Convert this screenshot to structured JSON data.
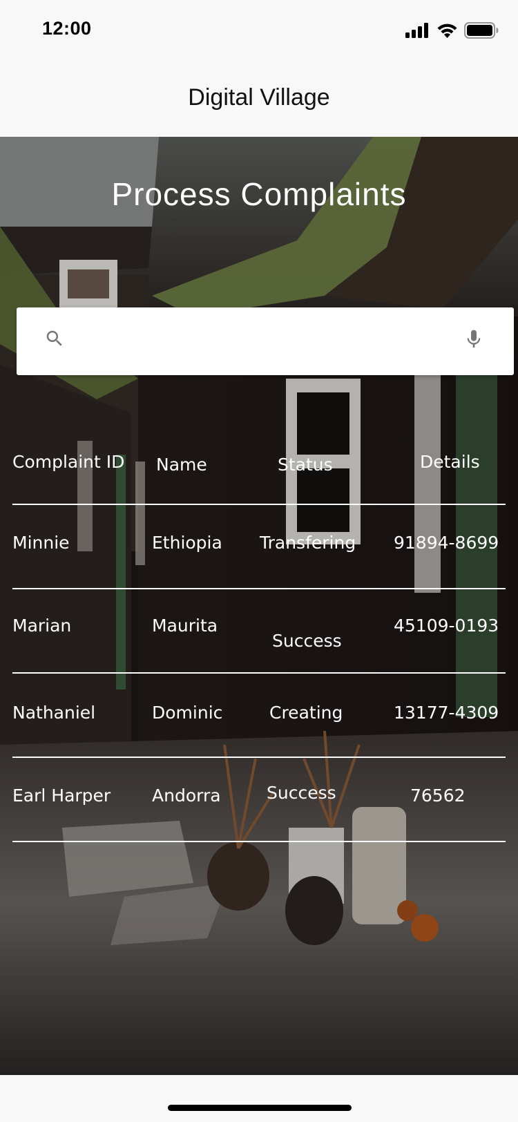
{
  "status_bar": {
    "time": "12:00",
    "icons": [
      "cellular-signal-icon",
      "wifi-icon",
      "battery-icon"
    ]
  },
  "app": {
    "title": "Digital Village"
  },
  "page": {
    "title": "Process Complaints"
  },
  "search": {
    "value": "",
    "placeholder": "",
    "icons": [
      "search-icon",
      "microphone-icon"
    ]
  },
  "table": {
    "headers": {
      "complaint_id": "Complaint ID",
      "name": "Name",
      "status": "Status",
      "details": "Details"
    },
    "rows": [
      {
        "complaint_id": "Minnie",
        "name": "Ethiopia",
        "status": "Transfering",
        "details": "91894-8699"
      },
      {
        "complaint_id": "Marian",
        "name": "Maurita",
        "status": "Success",
        "details": "45109-0193"
      },
      {
        "complaint_id": "Nathaniel",
        "name": "Dominic",
        "status": "Creating",
        "details": "13177-4309"
      },
      {
        "complaint_id": "Earl Harper",
        "name": "Andorra",
        "status": "Success",
        "details": "76562"
      }
    ]
  },
  "colors": {
    "bar_background": "#f8f8f8",
    "table_text": "#ffffff",
    "divider": "#ffffff",
    "search_background": "#ffffff",
    "icon_gray": "#757575"
  }
}
